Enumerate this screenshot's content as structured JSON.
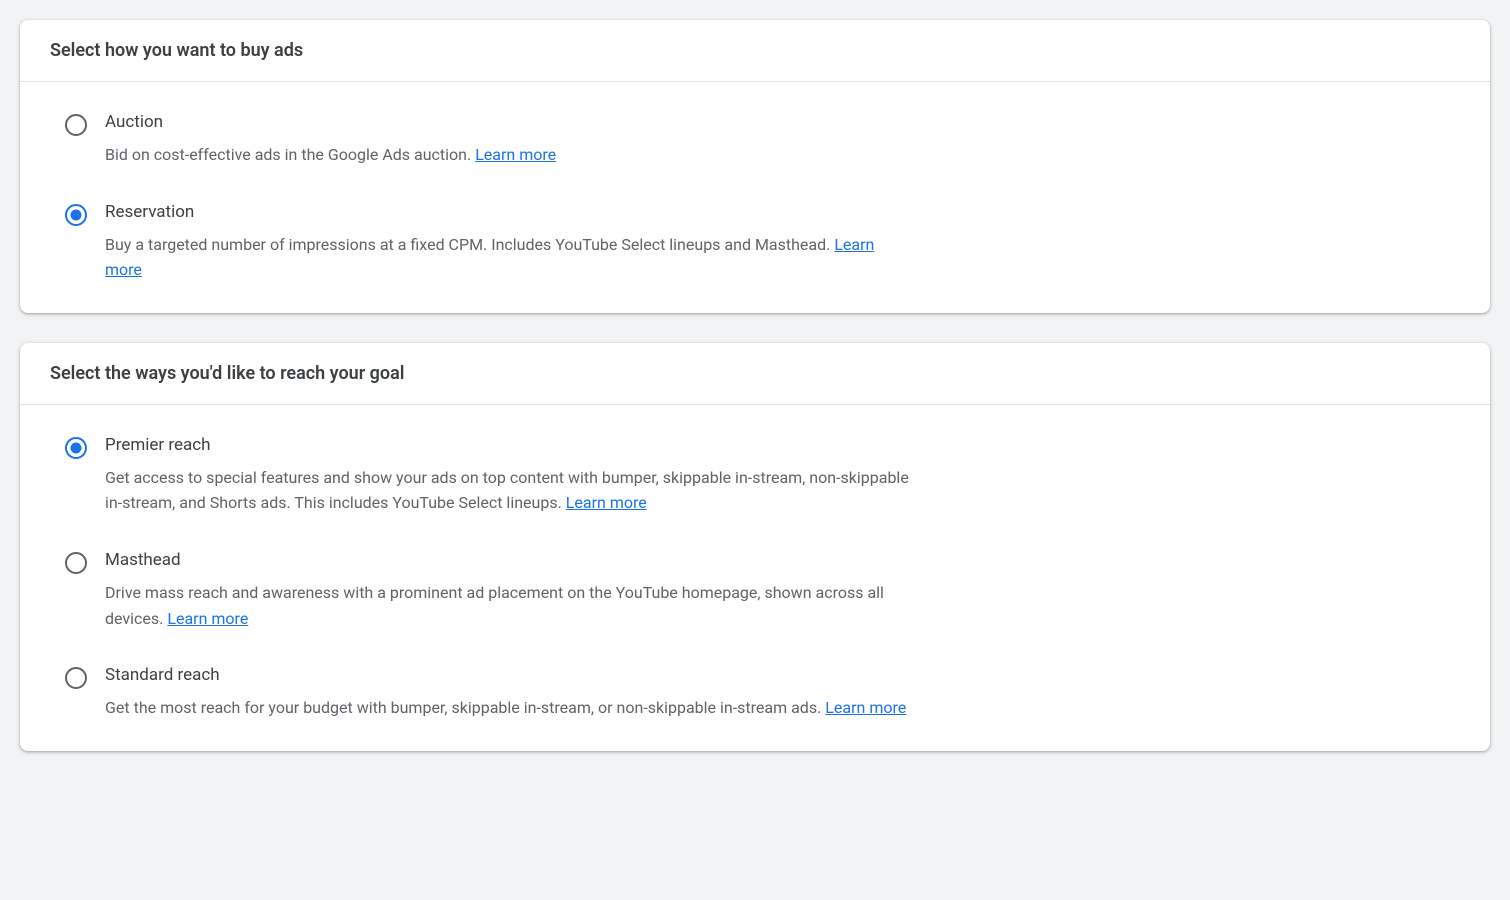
{
  "sections": {
    "buy": {
      "title": "Select how you want to buy ads",
      "options": {
        "auction": {
          "label": "Auction",
          "desc": "Bid on cost-effective ads in the Google Ads auction. ",
          "learn_more": "Learn more",
          "selected": false
        },
        "reservation": {
          "label": "Reservation",
          "desc": "Buy a targeted number of impressions at a fixed CPM. Includes YouTube Select lineups and Masthead. ",
          "learn_more": "Learn more",
          "selected": true
        }
      }
    },
    "reach": {
      "title": "Select the ways you'd like to reach your goal",
      "options": {
        "premier": {
          "label": "Premier reach",
          "desc": "Get access to special features and show your ads on top content with bumper, skippable in-stream, non-skippable in-stream, and Shorts ads. This includes YouTube Select lineups. ",
          "learn_more": "Learn more",
          "selected": true
        },
        "masthead": {
          "label": "Masthead",
          "desc": "Drive mass reach and awareness with a prominent ad placement on the YouTube homepage, shown across all devices. ",
          "learn_more": "Learn more",
          "selected": false
        },
        "standard": {
          "label": "Standard reach",
          "desc": "Get the most reach for your budget with bumper, skippable in-stream, or non-skippable in-stream ads. ",
          "learn_more": "Learn more",
          "selected": false
        }
      }
    }
  }
}
